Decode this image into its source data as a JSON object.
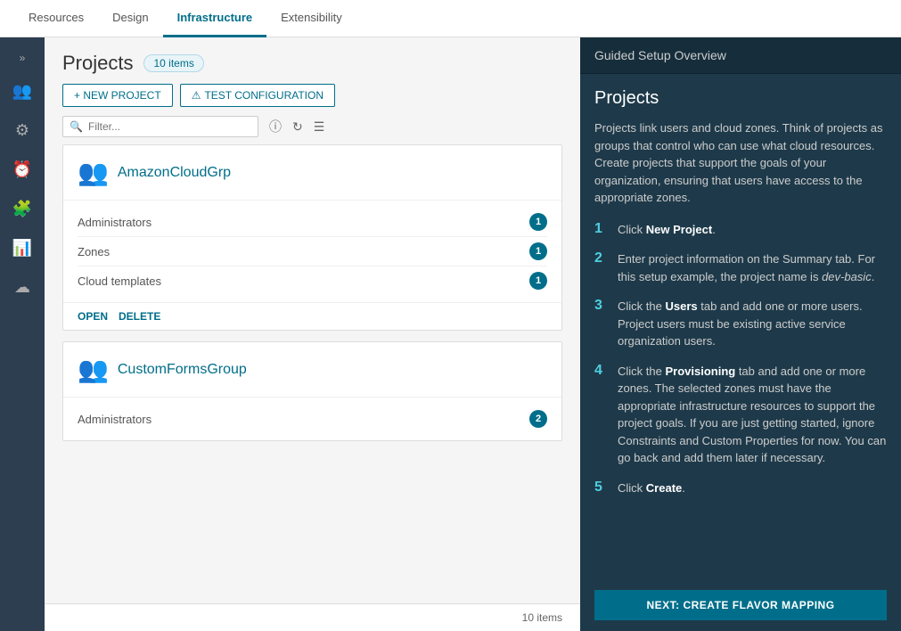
{
  "topNav": {
    "items": [
      {
        "id": "resources",
        "label": "Resources",
        "active": false
      },
      {
        "id": "design",
        "label": "Design",
        "active": false
      },
      {
        "id": "infrastructure",
        "label": "Infrastructure",
        "active": true
      },
      {
        "id": "extensibility",
        "label": "Extensibility",
        "active": false
      }
    ]
  },
  "sidebar": {
    "chevron": "»",
    "icons": [
      {
        "id": "users",
        "symbol": "👥",
        "active": true
      },
      {
        "id": "settings",
        "symbol": "⚙",
        "active": false
      },
      {
        "id": "clock",
        "symbol": "🕐",
        "active": false
      },
      {
        "id": "puzzle",
        "symbol": "🧩",
        "active": false
      },
      {
        "id": "chart",
        "symbol": "📊",
        "active": false
      },
      {
        "id": "cloud",
        "symbol": "☁",
        "active": false
      }
    ]
  },
  "projects": {
    "title": "Projects",
    "itemsBadge": "10 items",
    "toolbar": {
      "newProject": "+ NEW PROJECT",
      "testConfig": "TEST CONFIGURATION"
    },
    "filter": {
      "placeholder": "Filter..."
    },
    "cards": [
      {
        "id": "amazon",
        "name": "AmazonCloudGrp",
        "stats": [
          {
            "label": "Administrators",
            "count": "1"
          },
          {
            "label": "Zones",
            "count": "1"
          },
          {
            "label": "Cloud templates",
            "count": "1"
          }
        ],
        "actions": [
          "OPEN",
          "DELETE"
        ]
      },
      {
        "id": "customforms",
        "name": "CustomFormsGroup",
        "stats": [
          {
            "label": "Administrators",
            "count": "2"
          }
        ],
        "actions": []
      }
    ],
    "footerText": "10 items"
  },
  "guidedSetup": {
    "headerTitle": "Guided Setup Overview",
    "title": "Projects",
    "intro": "Projects link users and cloud zones. Think of projects as groups that control who can use what cloud resources. Create projects that support the goals of your organization, ensuring that users have access to the appropriate zones.",
    "steps": [
      {
        "num": "1",
        "text": "Click <strong>New Project</strong>."
      },
      {
        "num": "2",
        "text": "Enter project information on the Summary tab. For this setup example, the project name is <em>dev-basic</em>."
      },
      {
        "num": "3",
        "text": "Click the <strong>Users</strong> tab and add one or more users. Project users must be existing active service organization users."
      },
      {
        "num": "4",
        "text": "Click the <strong>Provisioning</strong> tab and add one or more zones. The selected zones must have the appropriate infrastructure resources to support the project goals. If you are just getting started, ignore Constraints and Custom Properties for now. You can go back and add them later if necessary."
      },
      {
        "num": "5",
        "text": "Click <strong>Create</strong>."
      }
    ],
    "nextButton": "NEXT: CREATE FLAVOR MAPPING"
  }
}
